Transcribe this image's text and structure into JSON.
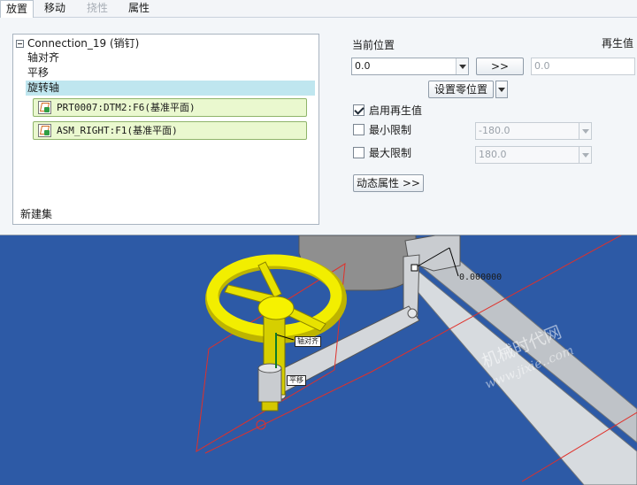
{
  "tabs": [
    {
      "label": "放置",
      "state": "active"
    },
    {
      "label": "移动",
      "state": "normal"
    },
    {
      "label": "挠性",
      "state": "disabled"
    },
    {
      "label": "属性",
      "state": "normal"
    }
  ],
  "tree": {
    "root": "Connection_19 (销钉)",
    "items": [
      "轴对齐",
      "平移",
      "旋转轴"
    ],
    "selected_item": "旋转轴",
    "references": [
      "PRT0007:DTM2:F6(基准平面)",
      "ASM_RIGHT:F1(基准平面)"
    ],
    "footer": "新建集"
  },
  "placement": {
    "current_position_label": "当前位置",
    "current_position_value": "0.0",
    "transfer_button": ">>",
    "regen_label": "再生值",
    "regen_value": "0.0",
    "set_zero_button": "设置零位置",
    "enable_regen_label": "启用再生值",
    "enable_regen_checked": true,
    "min_limit_label": "最小限制",
    "min_limit_checked": false,
    "min_limit_value": "-180.0",
    "max_limit_label": "最大限制",
    "max_limit_checked": false,
    "max_limit_value": "180.0",
    "dynamic_props_button": "动态属性 >>"
  },
  "viewport": {
    "tag_axis": "轴对齐",
    "tag_translate": "平移",
    "dimension_value": "0.000000",
    "watermark_cn": "机械时代网",
    "watermark_url": "www.jixie..com"
  },
  "colors": {
    "panel_bg": "#f3f6f9",
    "viewport_bg": "#2d5aa6",
    "selection": "#bfe6ef",
    "reference_bg": "#eaf8cf",
    "handwheel": "#f2ee00",
    "datum_plane": "#e0302a"
  },
  "icons": {
    "tree_expander": "minus-expander-icon",
    "reference": "datum-plane-reference-icon",
    "checkbox_checked": "checkmark-icon",
    "dropdown": "chevron-down-icon"
  }
}
